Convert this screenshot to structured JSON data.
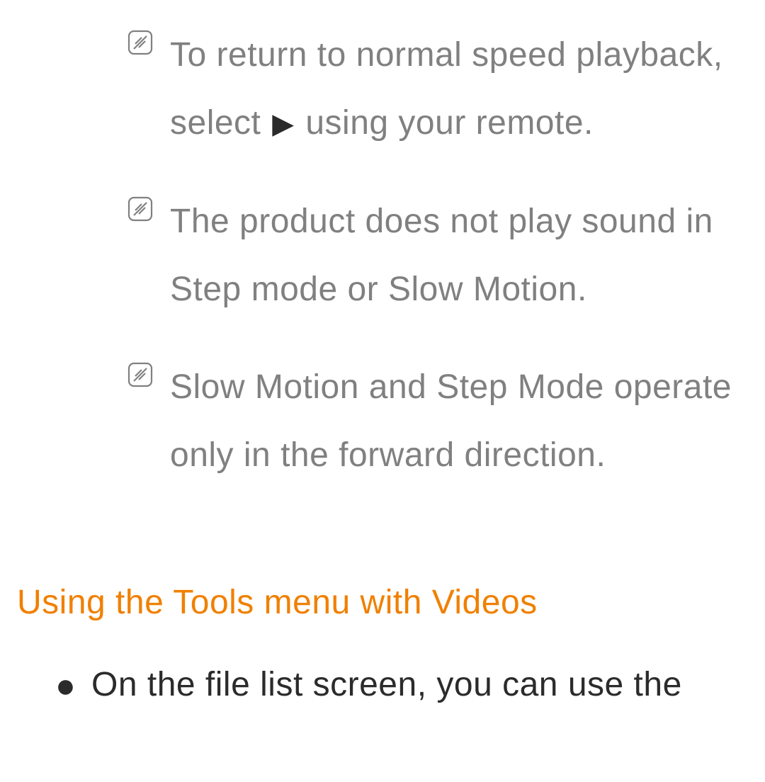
{
  "notes": [
    {
      "text_before_icon": "To return to normal speed playback, select ",
      "inline_icon": "▶",
      "text_after_icon": " using your remote."
    },
    {
      "text": "The product does not play sound in Step mode or Slow Motion."
    },
    {
      "text": "Slow Motion and Step Mode operate only in the forward direction."
    }
  ],
  "section_heading": "Using the Tools menu with Videos",
  "bullets": [
    {
      "text": "On the file list screen, you can use the"
    }
  ]
}
